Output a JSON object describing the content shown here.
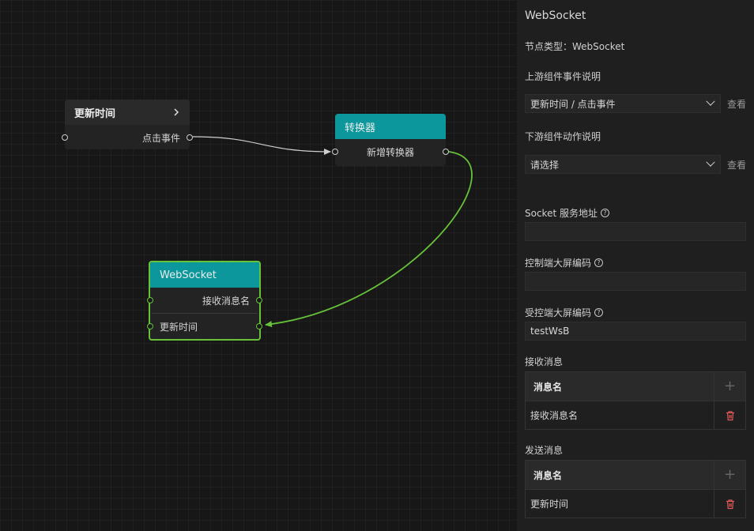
{
  "nodes": {
    "update": {
      "title": "更新时间",
      "port_out": "点击事件"
    },
    "convert": {
      "title": "转换器",
      "port": "新增转换器"
    },
    "ws": {
      "title": "WebSocket",
      "port1": "接收消息名",
      "port2": "更新时间"
    }
  },
  "panel": {
    "title": "WebSocket",
    "node_type": "节点类型：WebSocket",
    "upstream_label": "上游组件事件说明",
    "upstream_value": "更新时间 / 点击事件",
    "view_link": "查看",
    "downstream_label": "下游组件动作说明",
    "downstream_value": "请选择",
    "socket_label": "Socket 服务地址",
    "socket_value": "",
    "ctrl_label": "控制端大屏编码",
    "ctrl_value": "",
    "recv_screen_label": "受控端大屏编码",
    "recv_screen_value": "testWsB",
    "receive_label": "接收消息",
    "receive_table": {
      "header": "消息名",
      "rows": [
        "接收消息名"
      ]
    },
    "send_label": "发送消息",
    "send_table": {
      "header": "消息名",
      "rows": [
        "更新时间"
      ]
    }
  },
  "colors": {
    "teal": "#0b979c",
    "green": "#67c23a",
    "danger": "#e05a5a"
  }
}
